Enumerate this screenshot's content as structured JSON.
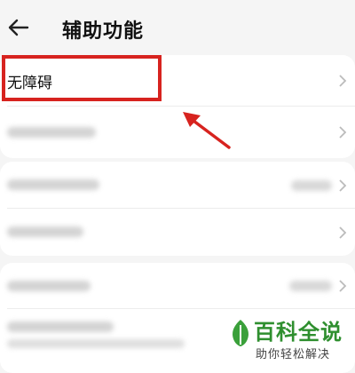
{
  "header": {
    "title": "辅助功能",
    "back_icon": "back-arrow-icon"
  },
  "rows": [
    {
      "label": "无障碍",
      "has_chevron": true
    },
    {
      "label": "",
      "has_chevron": true
    },
    {
      "label": "",
      "has_chevron": true
    },
    {
      "label": "",
      "has_chevron": true
    },
    {
      "label": "",
      "has_chevron": true
    },
    {
      "label": "",
      "has_chevron": false
    }
  ],
  "annotation": {
    "highlight_color": "#d7231f"
  },
  "watermark": {
    "main": "百科全说",
    "sub": "助你轻松解决",
    "color": "#2f8f2f"
  }
}
